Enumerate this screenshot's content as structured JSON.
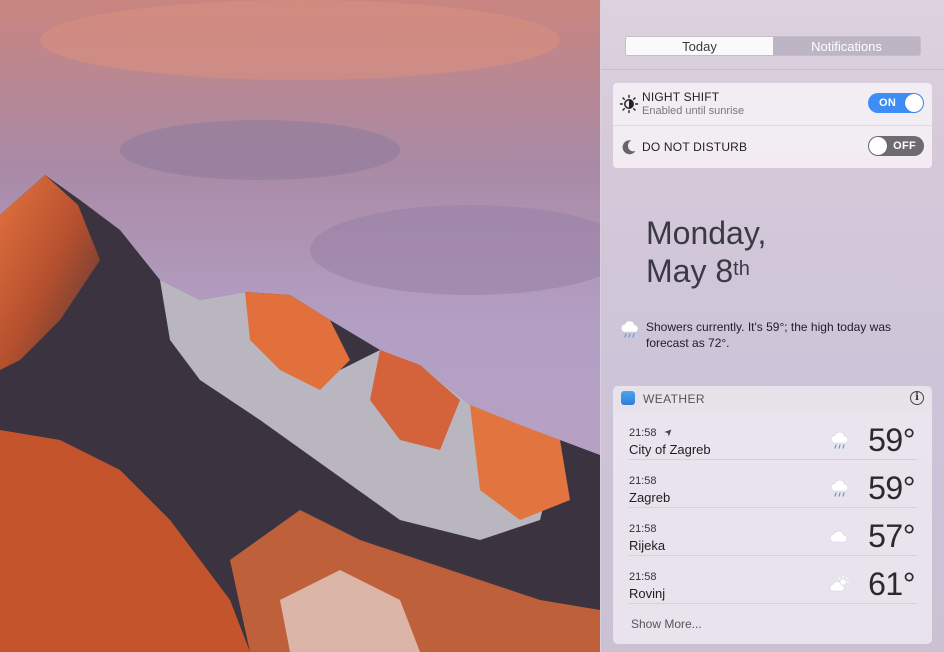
{
  "tabs": [
    {
      "label": "Today",
      "active": true
    },
    {
      "label": "Notifications",
      "active": false
    }
  ],
  "toggles": {
    "night_shift": {
      "title": "NIGHT SHIFT",
      "subtitle": "Enabled until sunrise",
      "state": "ON",
      "icon": "sun-moon-icon"
    },
    "do_not_disturb": {
      "title": "DO NOT DISTURB",
      "state": "OFF",
      "icon": "moon-icon"
    }
  },
  "date": {
    "weekday": "Monday,",
    "month_day": "May 8",
    "suffix": "th"
  },
  "summary": {
    "icon": "cloud-rain-icon",
    "text": "Showers currently. It's 59°; the high today was forecast as 72°."
  },
  "weather": {
    "title": "WEATHER",
    "info_icon": "i",
    "rows": [
      {
        "time": "21:58",
        "city": "City of Zagreb",
        "location_arrow": "➤",
        "condition": "showers",
        "temp": "59°"
      },
      {
        "time": "21:58",
        "city": "Zagreb",
        "condition": "showers",
        "temp": "59°"
      },
      {
        "time": "21:58",
        "city": "Rijeka",
        "condition": "cloudy",
        "temp": "57°"
      },
      {
        "time": "21:58",
        "city": "Rovinj",
        "condition": "partly-cloudy",
        "temp": "61°"
      }
    ],
    "show_more": "Show More..."
  },
  "colors": {
    "accent": "#3d8df5",
    "toggle_off": "#6e6a72"
  }
}
